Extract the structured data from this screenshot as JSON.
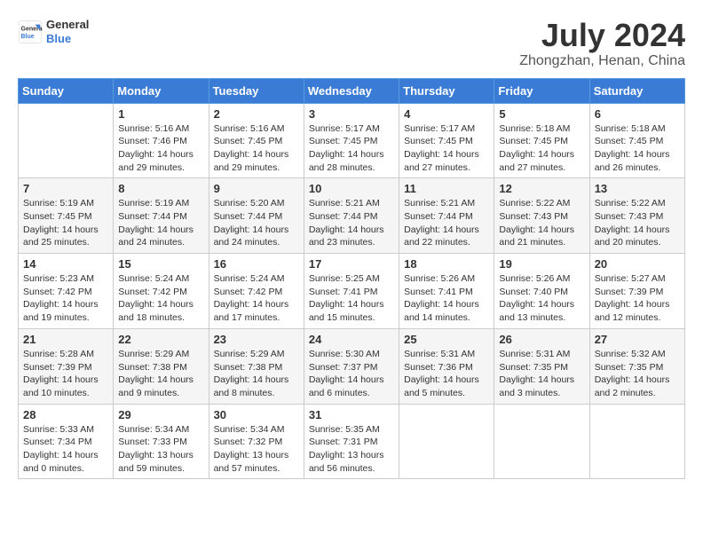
{
  "header": {
    "logo_line1": "General",
    "logo_line2": "Blue",
    "month_title": "July 2024",
    "location": "Zhongzhan, Henan, China"
  },
  "weekdays": [
    "Sunday",
    "Monday",
    "Tuesday",
    "Wednesday",
    "Thursday",
    "Friday",
    "Saturday"
  ],
  "weeks": [
    [
      {
        "day": "",
        "sunrise": "",
        "sunset": "",
        "daylight": ""
      },
      {
        "day": "1",
        "sunrise": "Sunrise: 5:16 AM",
        "sunset": "Sunset: 7:46 PM",
        "daylight": "Daylight: 14 hours and 29 minutes."
      },
      {
        "day": "2",
        "sunrise": "Sunrise: 5:16 AM",
        "sunset": "Sunset: 7:45 PM",
        "daylight": "Daylight: 14 hours and 29 minutes."
      },
      {
        "day": "3",
        "sunrise": "Sunrise: 5:17 AM",
        "sunset": "Sunset: 7:45 PM",
        "daylight": "Daylight: 14 hours and 28 minutes."
      },
      {
        "day": "4",
        "sunrise": "Sunrise: 5:17 AM",
        "sunset": "Sunset: 7:45 PM",
        "daylight": "Daylight: 14 hours and 27 minutes."
      },
      {
        "day": "5",
        "sunrise": "Sunrise: 5:18 AM",
        "sunset": "Sunset: 7:45 PM",
        "daylight": "Daylight: 14 hours and 27 minutes."
      },
      {
        "day": "6",
        "sunrise": "Sunrise: 5:18 AM",
        "sunset": "Sunset: 7:45 PM",
        "daylight": "Daylight: 14 hours and 26 minutes."
      }
    ],
    [
      {
        "day": "7",
        "sunrise": "Sunrise: 5:19 AM",
        "sunset": "Sunset: 7:45 PM",
        "daylight": "Daylight: 14 hours and 25 minutes."
      },
      {
        "day": "8",
        "sunrise": "Sunrise: 5:19 AM",
        "sunset": "Sunset: 7:44 PM",
        "daylight": "Daylight: 14 hours and 24 minutes."
      },
      {
        "day": "9",
        "sunrise": "Sunrise: 5:20 AM",
        "sunset": "Sunset: 7:44 PM",
        "daylight": "Daylight: 14 hours and 24 minutes."
      },
      {
        "day": "10",
        "sunrise": "Sunrise: 5:21 AM",
        "sunset": "Sunset: 7:44 PM",
        "daylight": "Daylight: 14 hours and 23 minutes."
      },
      {
        "day": "11",
        "sunrise": "Sunrise: 5:21 AM",
        "sunset": "Sunset: 7:44 PM",
        "daylight": "Daylight: 14 hours and 22 minutes."
      },
      {
        "day": "12",
        "sunrise": "Sunrise: 5:22 AM",
        "sunset": "Sunset: 7:43 PM",
        "daylight": "Daylight: 14 hours and 21 minutes."
      },
      {
        "day": "13",
        "sunrise": "Sunrise: 5:22 AM",
        "sunset": "Sunset: 7:43 PM",
        "daylight": "Daylight: 14 hours and 20 minutes."
      }
    ],
    [
      {
        "day": "14",
        "sunrise": "Sunrise: 5:23 AM",
        "sunset": "Sunset: 7:42 PM",
        "daylight": "Daylight: 14 hours and 19 minutes."
      },
      {
        "day": "15",
        "sunrise": "Sunrise: 5:24 AM",
        "sunset": "Sunset: 7:42 PM",
        "daylight": "Daylight: 14 hours and 18 minutes."
      },
      {
        "day": "16",
        "sunrise": "Sunrise: 5:24 AM",
        "sunset": "Sunset: 7:42 PM",
        "daylight": "Daylight: 14 hours and 17 minutes."
      },
      {
        "day": "17",
        "sunrise": "Sunrise: 5:25 AM",
        "sunset": "Sunset: 7:41 PM",
        "daylight": "Daylight: 14 hours and 15 minutes."
      },
      {
        "day": "18",
        "sunrise": "Sunrise: 5:26 AM",
        "sunset": "Sunset: 7:41 PM",
        "daylight": "Daylight: 14 hours and 14 minutes."
      },
      {
        "day": "19",
        "sunrise": "Sunrise: 5:26 AM",
        "sunset": "Sunset: 7:40 PM",
        "daylight": "Daylight: 14 hours and 13 minutes."
      },
      {
        "day": "20",
        "sunrise": "Sunrise: 5:27 AM",
        "sunset": "Sunset: 7:39 PM",
        "daylight": "Daylight: 14 hours and 12 minutes."
      }
    ],
    [
      {
        "day": "21",
        "sunrise": "Sunrise: 5:28 AM",
        "sunset": "Sunset: 7:39 PM",
        "daylight": "Daylight: 14 hours and 10 minutes."
      },
      {
        "day": "22",
        "sunrise": "Sunrise: 5:29 AM",
        "sunset": "Sunset: 7:38 PM",
        "daylight": "Daylight: 14 hours and 9 minutes."
      },
      {
        "day": "23",
        "sunrise": "Sunrise: 5:29 AM",
        "sunset": "Sunset: 7:38 PM",
        "daylight": "Daylight: 14 hours and 8 minutes."
      },
      {
        "day": "24",
        "sunrise": "Sunrise: 5:30 AM",
        "sunset": "Sunset: 7:37 PM",
        "daylight": "Daylight: 14 hours and 6 minutes."
      },
      {
        "day": "25",
        "sunrise": "Sunrise: 5:31 AM",
        "sunset": "Sunset: 7:36 PM",
        "daylight": "Daylight: 14 hours and 5 minutes."
      },
      {
        "day": "26",
        "sunrise": "Sunrise: 5:31 AM",
        "sunset": "Sunset: 7:35 PM",
        "daylight": "Daylight: 14 hours and 3 minutes."
      },
      {
        "day": "27",
        "sunrise": "Sunrise: 5:32 AM",
        "sunset": "Sunset: 7:35 PM",
        "daylight": "Daylight: 14 hours and 2 minutes."
      }
    ],
    [
      {
        "day": "28",
        "sunrise": "Sunrise: 5:33 AM",
        "sunset": "Sunset: 7:34 PM",
        "daylight": "Daylight: 14 hours and 0 minutes."
      },
      {
        "day": "29",
        "sunrise": "Sunrise: 5:34 AM",
        "sunset": "Sunset: 7:33 PM",
        "daylight": "Daylight: 13 hours and 59 minutes."
      },
      {
        "day": "30",
        "sunrise": "Sunrise: 5:34 AM",
        "sunset": "Sunset: 7:32 PM",
        "daylight": "Daylight: 13 hours and 57 minutes."
      },
      {
        "day": "31",
        "sunrise": "Sunrise: 5:35 AM",
        "sunset": "Sunset: 7:31 PM",
        "daylight": "Daylight: 13 hours and 56 minutes."
      },
      {
        "day": "",
        "sunrise": "",
        "sunset": "",
        "daylight": ""
      },
      {
        "day": "",
        "sunrise": "",
        "sunset": "",
        "daylight": ""
      },
      {
        "day": "",
        "sunrise": "",
        "sunset": "",
        "daylight": ""
      }
    ]
  ]
}
